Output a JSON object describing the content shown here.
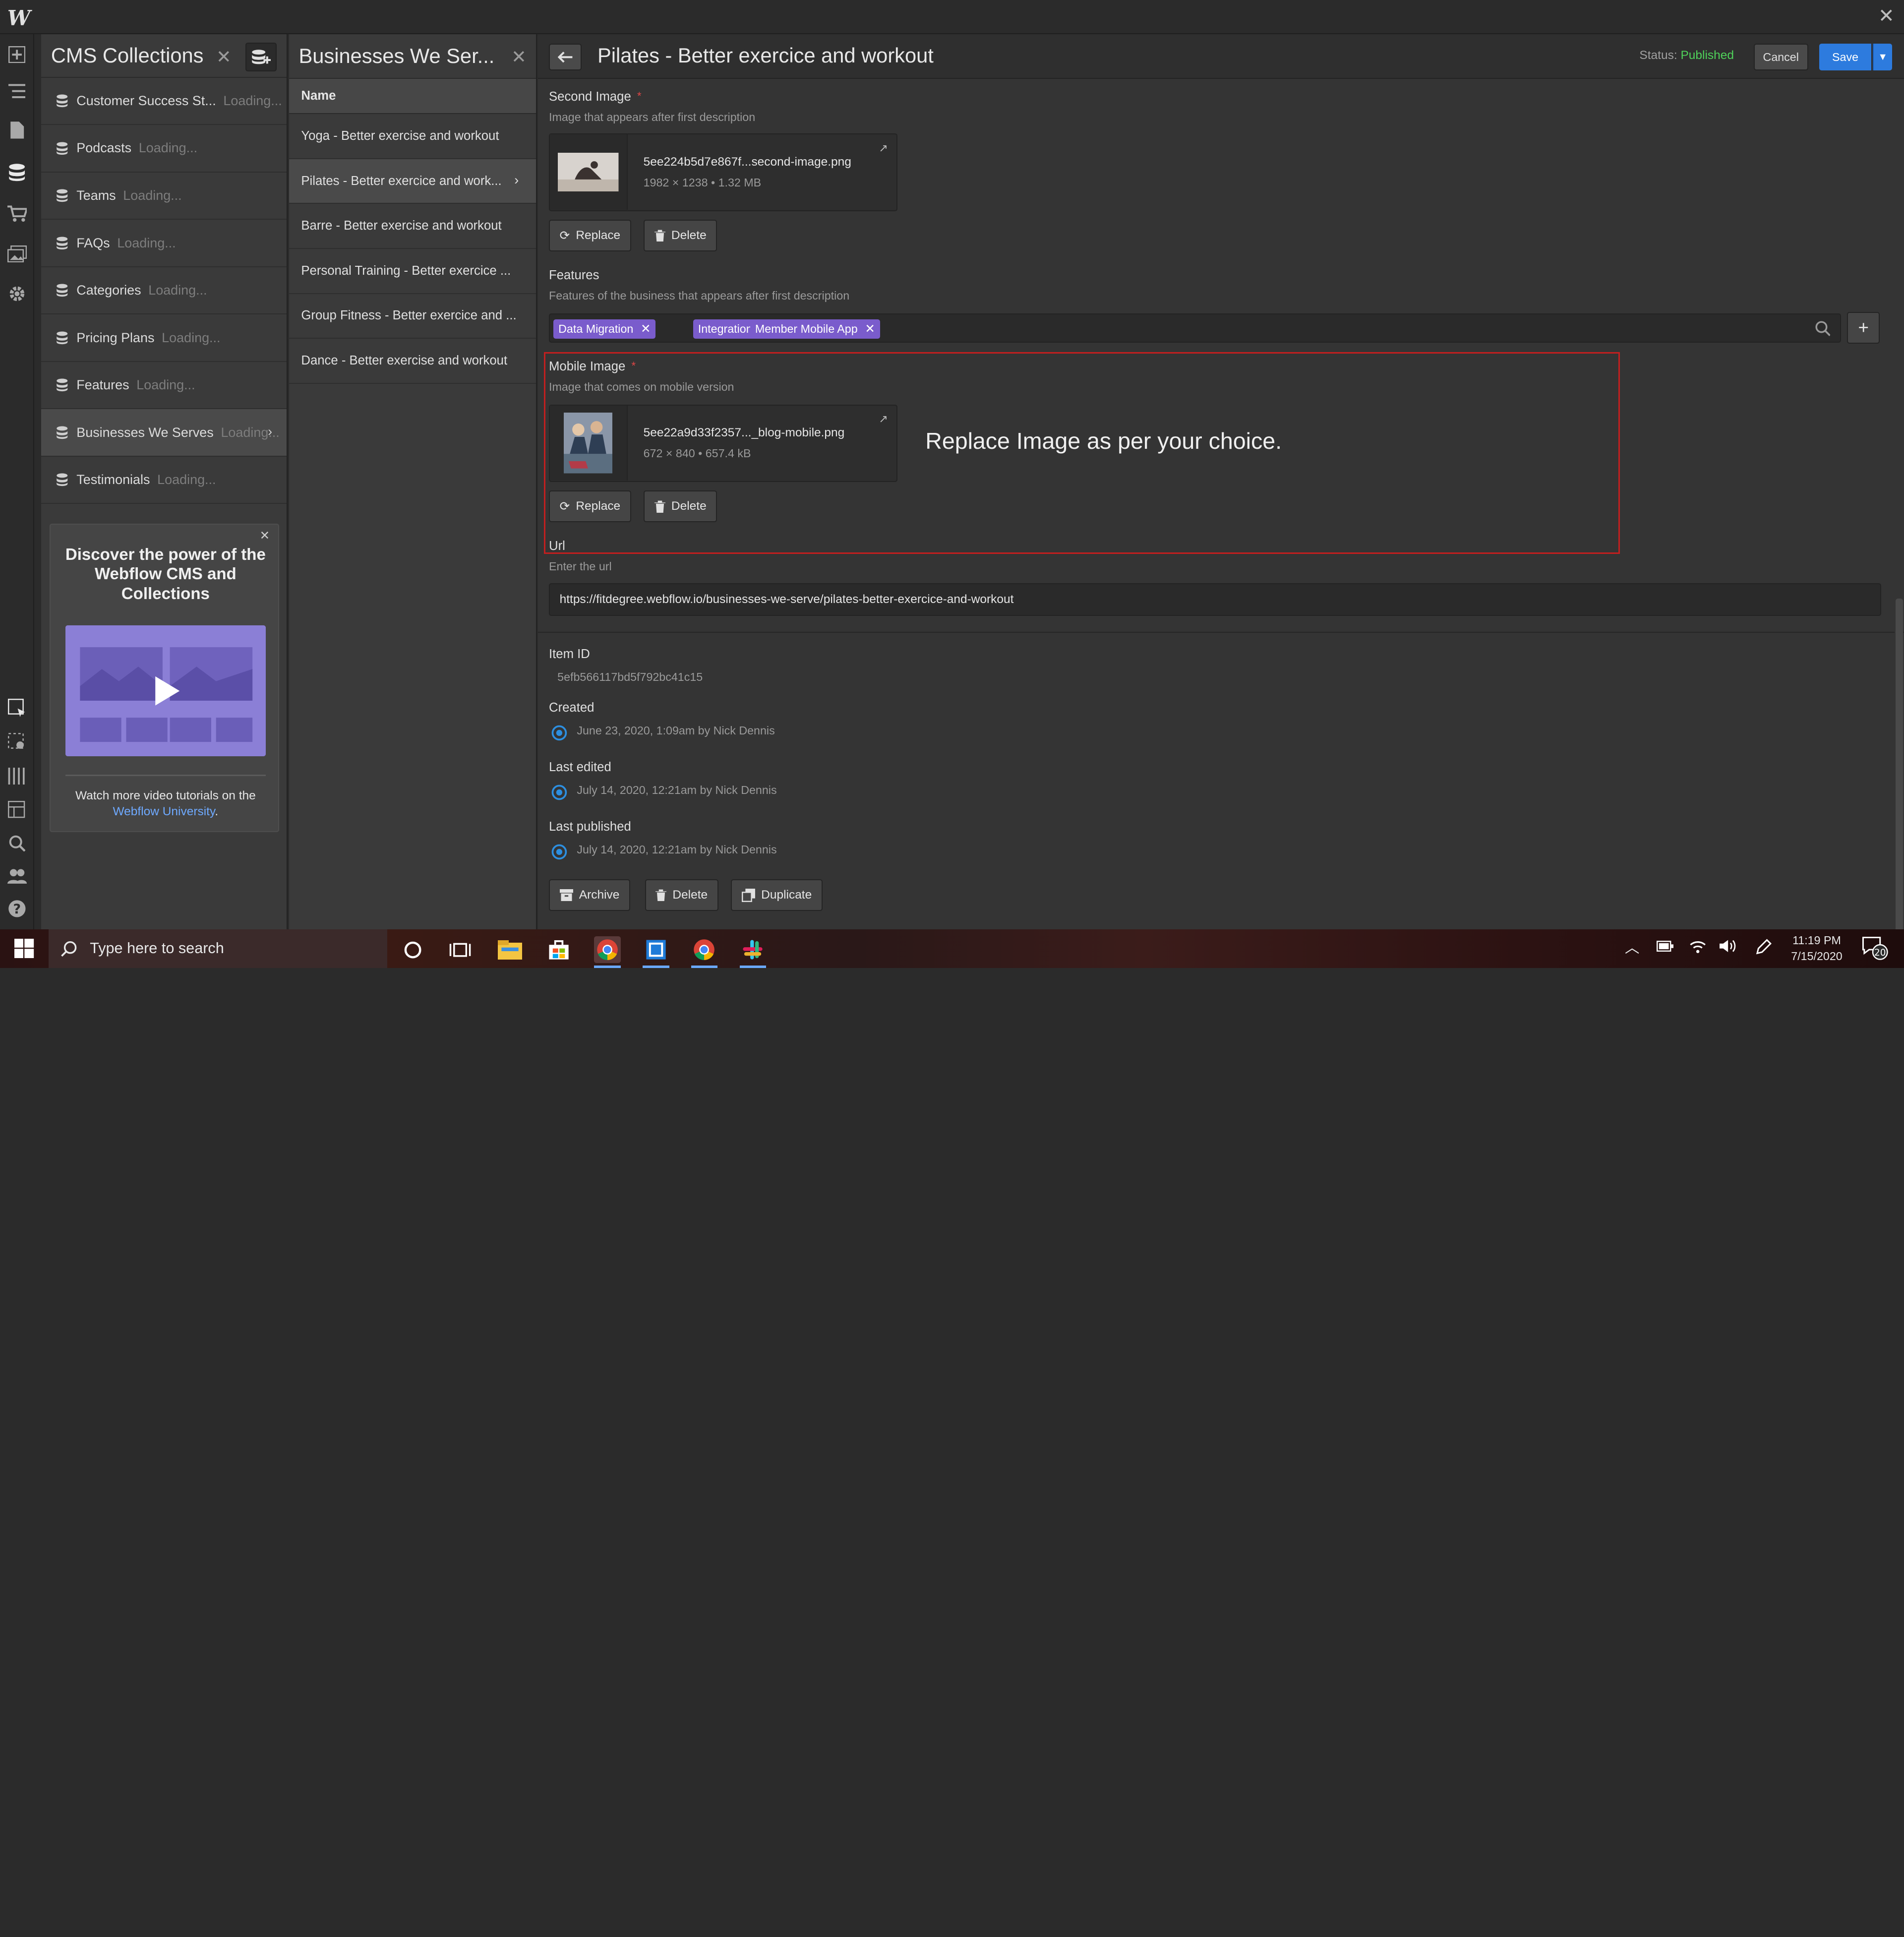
{
  "app": {
    "logo": "W",
    "close": "✕"
  },
  "cms": {
    "title": "CMS Collections",
    "collections": [
      {
        "label": "Customer Success St...",
        "status": "Loading..."
      },
      {
        "label": "Podcasts",
        "status": "Loading..."
      },
      {
        "label": "Teams",
        "status": "Loading..."
      },
      {
        "label": "FAQs",
        "status": "Loading..."
      },
      {
        "label": "Categories",
        "status": "Loading..."
      },
      {
        "label": "Pricing Plans",
        "status": "Loading..."
      },
      {
        "label": "Features",
        "status": "Loading..."
      },
      {
        "label": "Businesses We Serves",
        "status": "Loading..."
      },
      {
        "label": "Testimonials",
        "status": "Loading..."
      }
    ],
    "promo": {
      "title": "Discover the power of the Webflow CMS and Collections",
      "text": "Watch more video tutorials on the",
      "link": "Webflow University",
      "period": "."
    }
  },
  "items_panel": {
    "title": "Businesses We Ser...",
    "column": "Name",
    "items": [
      "Yoga - Better exercise and workout",
      "Pilates - Better exercice and work...",
      "Barre - Better exercise and workout",
      "Personal Training - Better exercice ...",
      "Group Fitness - Better exercice and ...",
      "Dance - Better exercise and workout"
    ]
  },
  "editor": {
    "title": "Pilates - Better exercice and workout",
    "status_label": "Status:",
    "status_value": "Published",
    "cancel": "Cancel",
    "save": "Save",
    "second_image": {
      "label": "Second Image",
      "required": "*",
      "help": "Image that appears after first description",
      "filename": "5ee224b5d7e867f...second-image.png",
      "meta": "1982 × 1238 • 1.32 MB"
    },
    "replace": "Replace",
    "delete": "Delete",
    "features": {
      "label": "Features",
      "help": "Features of the business that appears after first description",
      "tags": [
        "Data Migration",
        "Integrations",
        "Member Mobile App"
      ]
    },
    "mobile_image": {
      "label": "Mobile Image",
      "required": "*",
      "help": "Image that comes on mobile version",
      "filename": "5ee22a9d33f2357..._blog-mobile.png",
      "meta": "672 × 840 • 657.4 kB"
    },
    "annotation": "Replace Image as per your choice.",
    "url": {
      "label": "Url",
      "help": "Enter the url",
      "value": "https://fitdegree.webflow.io/businesses-we-serve/pilates-better-exercice-and-workout"
    },
    "item_id": {
      "label": "Item ID",
      "value": "5efb566117bd5f792bc41c15"
    },
    "created": {
      "label": "Created",
      "value": "June 23, 2020, 1:09am by Nick Dennis"
    },
    "last_edited": {
      "label": "Last edited",
      "value": "July 14, 2020, 12:21am by Nick Dennis"
    },
    "last_published": {
      "label": "Last published",
      "value": "July 14, 2020, 12:21am by Nick Dennis"
    },
    "archive": "Archive",
    "duplicate": "Duplicate"
  },
  "taskbar": {
    "search_placeholder": "Type here to search",
    "time": "11:19 PM",
    "date": "7/15/2020",
    "notifications": "20"
  },
  "colors": {
    "accent": "#2d7bde",
    "published": "#4fd15a",
    "tag": "#7a5ccc",
    "highlight": "#c21f1f"
  }
}
